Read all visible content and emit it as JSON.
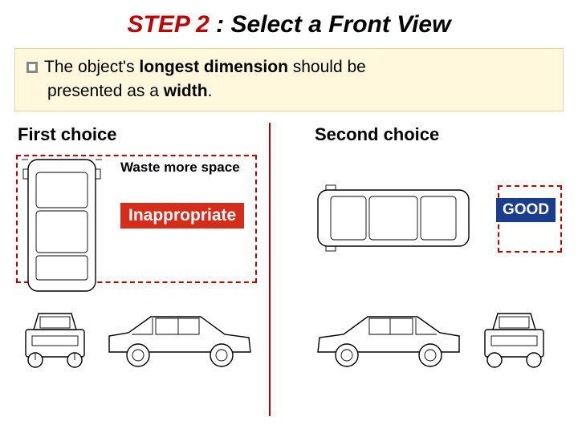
{
  "title": {
    "step_label": "STEP 2",
    "rest": " : Select  a  Front  View"
  },
  "callout": {
    "line1_pre": "The object's ",
    "line1_bold": "longest dimension",
    "line1_post": " should be",
    "line2_pre": "presented as a ",
    "line2_bold": "width",
    "line2_post": "."
  },
  "left": {
    "heading": "First choice",
    "waste_label": "Waste more space",
    "tag": "Inappropriate"
  },
  "right": {
    "heading": "Second choice",
    "tag": "GOOD"
  }
}
